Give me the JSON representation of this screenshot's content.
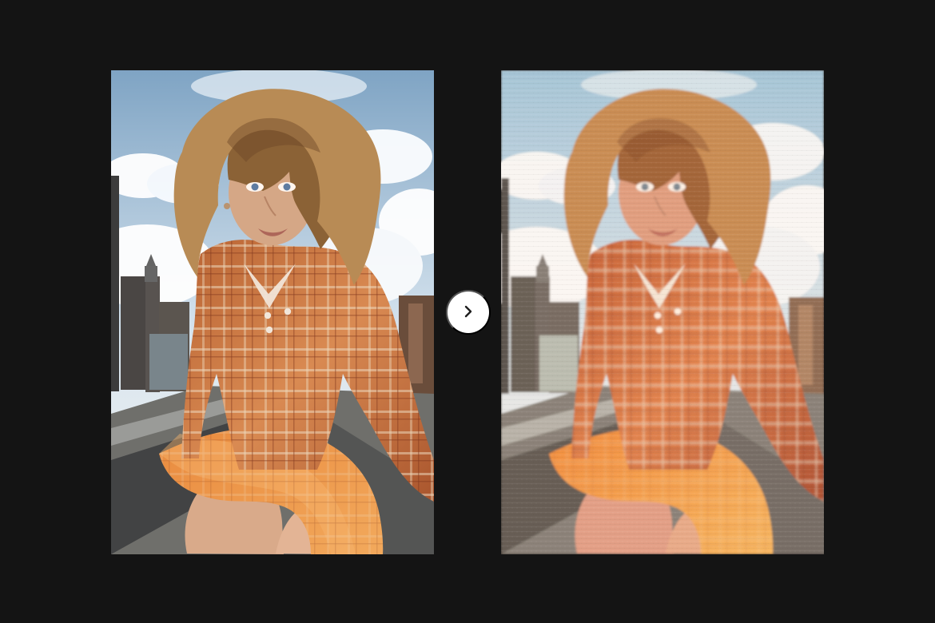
{
  "comparison": {
    "before": {
      "kind": "original-photo",
      "subject": "woman-with-curly-blonde-hair-on-rooftop"
    },
    "after": {
      "kind": "vintage-print-effect",
      "subject": "woman-with-curly-blonde-hair-on-rooftop"
    },
    "next_control": {
      "icon": "chevron-right-icon"
    }
  },
  "colors": {
    "background": "#141414",
    "button": "#ffffff",
    "sky": "#b9d3e5",
    "plaid": "#c96f39",
    "skirt": "#ef9a47"
  }
}
